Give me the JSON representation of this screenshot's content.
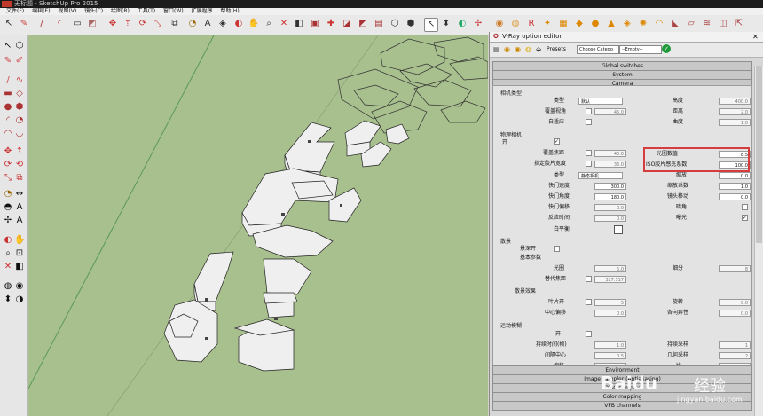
{
  "window": {
    "title": "无标题 - SketchUp Pro 2015"
  },
  "menu": [
    "文件(F)",
    "编辑(E)",
    "视图(V)",
    "镜头(C)",
    "绘图(R)",
    "工具(T)",
    "窗口(W)",
    "扩展程序",
    "帮助(H)"
  ],
  "panel": {
    "title": "V-Ray option editor",
    "presets_label": "Presets",
    "preset_category": "Choose Catego",
    "preset_value": "--Empty--",
    "rollouts_top": [
      "Global switches",
      "System",
      "Camera"
    ],
    "rollouts_bottom": [
      "Environment",
      "Image sampler (Antialiasing)",
      "DMC sampler",
      "Color mapping",
      "VFB channels"
    ]
  },
  "camera": {
    "type_section": "相机类型",
    "type_label": "类型",
    "type_value": "默认",
    "override_fov_label": "覆盖视角",
    "fov_value": "45.0",
    "auto_fit_label": "自适应",
    "height_label": "高度",
    "height_value": "400.0",
    "distance_label": "距离",
    "distance_value": "2.0",
    "curve_label": "曲度",
    "curve_value": "1.0",
    "physical_section": "物理相机",
    "on_label": "开",
    "override_focal_label": "覆盖焦距",
    "focal_value": "40.0",
    "film_width_label": "指定胶片宽度",
    "film_width_value": "36.0",
    "f_number_label": "光圈数值",
    "f_number_value": "8.5",
    "iso_label": "ISO胶片感光系数",
    "iso_value": "100.0",
    "ptype_label": "类型",
    "ptype_value": "静态相机",
    "zoom_label": "缩放",
    "zoom_value": "0.0",
    "shutter_speed_label": "快门速度",
    "shutter_speed_value": "300.0",
    "zoom_factor_label": "缩放系数",
    "zoom_factor_value": "1.0",
    "shutter_angle_label": "快门角度",
    "shutter_angle_value": "180.0",
    "lens_shift_label": "镜头移动",
    "lens_shift_value": "0.0",
    "shutter_offset_label": "快门偏移",
    "shutter_offset_value": "0.0",
    "vignette_label": "暗角",
    "latency_label": "反应时间",
    "latency_value": "0.0",
    "exposure_label": "曝光",
    "wb_label": "白平衡",
    "bokeh_section": "散景",
    "bokeh_on_label": "景深开",
    "basic_params_label": "基本参数",
    "aperture_label": "光圈",
    "aperture_value": "5.0",
    "subdiv_label": "细分",
    "subdiv_value": "8",
    "focal_dist_label": "替代焦距",
    "focal_dist_value": "327.517",
    "bokeh_effect_section": "散景效果",
    "blades_label": "叶片开",
    "blades_value": "5",
    "rotation_label": "旋转",
    "rotation_value": "0.0",
    "center_bias_label": "中心偏移",
    "center_bias_value": "0.0",
    "anisotropy_label": "各向异性",
    "anisotropy_value": "0.0",
    "motion_blur_section": "运动模糊",
    "mb_on_label": "开",
    "duration_label": "持续时间(帧)",
    "duration_value": "1.0",
    "mb_subdiv_label": "持续采样",
    "mb_subdiv_value": "1",
    "interval_center_label": "间隔中心",
    "interval_center_value": "0.5",
    "geo_samples_label": "几何采样",
    "geo_samples_value": "2",
    "bias_label": "偏移",
    "bias_value": "0.0",
    "blur_label": "比",
    "blur_value": "0"
  },
  "watermark": {
    "brand": "Baidu",
    "jingyan": "经验",
    "url": "jingyan.baidu.com"
  }
}
